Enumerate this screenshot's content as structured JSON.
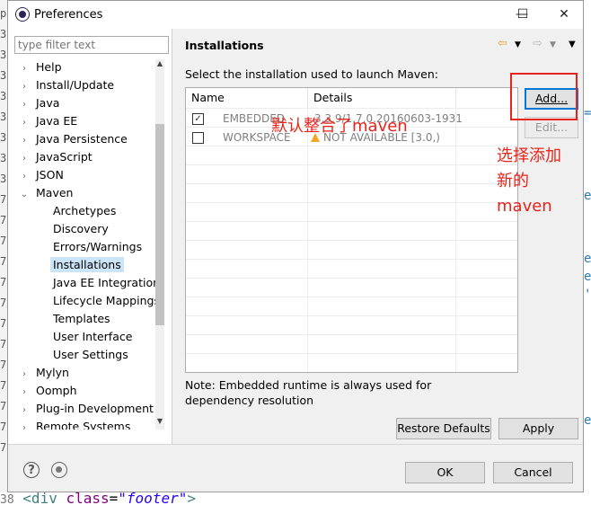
{
  "background": {
    "left_chars": [
      "p",
      "3",
      "3",
      "3",
      "3",
      "3",
      "3",
      "3",
      "3",
      "7",
      "7",
      "7",
      "7",
      "7",
      "7",
      "7",
      "7",
      "7",
      "7",
      "7",
      "7",
      "7"
    ],
    "right_chars": [
      "=",
      "e",
      "e",
      "e",
      "'",
      "e"
    ],
    "bottom": {
      "line": "38",
      "tag_open": "<div",
      "attr": "class",
      "eq": "=",
      "value": "\"footer\"",
      "tag_close": ">"
    }
  },
  "dialog": {
    "title": "Preferences",
    "minimize_glyph": "—",
    "maximize_glyph": "☐",
    "close_glyph": "✕"
  },
  "left": {
    "filter_placeholder": "type filter text",
    "tree": [
      {
        "label": "Help",
        "arrow": ">"
      },
      {
        "label": "Install/Update",
        "arrow": ">"
      },
      {
        "label": "Java",
        "arrow": ">"
      },
      {
        "label": "Java EE",
        "arrow": ">"
      },
      {
        "label": "Java Persistence",
        "arrow": ">"
      },
      {
        "label": "JavaScript",
        "arrow": ">"
      },
      {
        "label": "JSON",
        "arrow": ">"
      },
      {
        "label": "Maven",
        "arrow": "v"
      },
      {
        "label": "Archetypes",
        "arrow": ""
      },
      {
        "label": "Discovery",
        "arrow": ""
      },
      {
        "label": "Errors/Warnings",
        "arrow": ""
      },
      {
        "label": "Installations",
        "arrow": ""
      },
      {
        "label": "Java EE Integration",
        "arrow": ""
      },
      {
        "label": "Lifecycle Mappings",
        "arrow": ""
      },
      {
        "label": "Templates",
        "arrow": ""
      },
      {
        "label": "User Interface",
        "arrow": ""
      },
      {
        "label": "User Settings",
        "arrow": ""
      },
      {
        "label": "Mylyn",
        "arrow": ">"
      },
      {
        "label": "Oomph",
        "arrow": ">"
      },
      {
        "label": "Plug-in Development",
        "arrow": ">"
      },
      {
        "label": "Remote Systems",
        "arrow": ">"
      }
    ]
  },
  "right": {
    "title": "Installations",
    "prompt": "Select the installation used to launch Maven:",
    "columns": [
      "Name",
      "Details"
    ],
    "rows": [
      {
        "checked": true,
        "name": "EMBEDDED",
        "details": "3.3.9/1.7.0.20160603-1931"
      },
      {
        "checked": false,
        "name": "WORKSPACE",
        "details": "NOT AVAILABLE [3.0,)"
      }
    ],
    "add_button": "Add...",
    "edit_button": "Edit...",
    "note": "Note: Embedded runtime is always used for dependency resolution",
    "restore_defaults": "Restore Defaults",
    "apply": "Apply"
  },
  "footer": {
    "ok": "OK",
    "cancel": "Cancel"
  },
  "annotations": {
    "default_note": "默认整合了maven",
    "add_note_line1": "选择添加",
    "add_note_line2": "新的",
    "add_note_line3": "maven",
    "color": "#e8231b"
  }
}
